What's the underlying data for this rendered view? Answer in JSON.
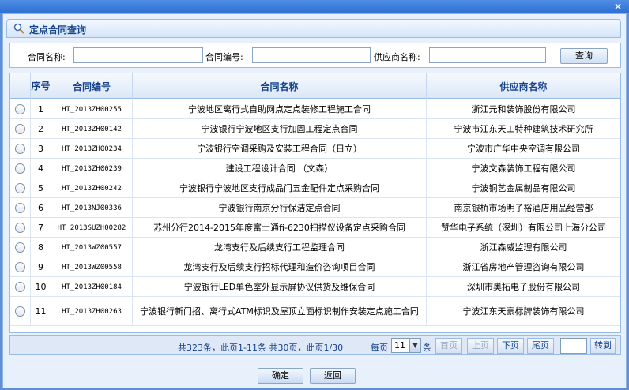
{
  "window": {
    "close_glyph": "×"
  },
  "panel": {
    "title": "定点合同查询",
    "icon": "search-icon"
  },
  "search": {
    "contract_name_label": "合同名称:",
    "contract_name_value": "",
    "contract_no_label": "合同编号:",
    "contract_no_value": "",
    "supplier_label": "供应商名称:",
    "supplier_value": "",
    "query_button": "查询"
  },
  "grid": {
    "columns": [
      "序号",
      "合同编号",
      "合同名称",
      "供应商名称"
    ],
    "rows": [
      {
        "no": "1",
        "code": "HT_2013ZH00255",
        "name": "宁波地区离行式自助网点定点装修工程施工合同",
        "supplier": "浙江元和装饰股份有限公司"
      },
      {
        "no": "2",
        "code": "HT_2013ZH00142",
        "name": "宁波银行宁波地区支行加固工程定点合同",
        "supplier": "宁波市江东天工特种建筑技术研究所"
      },
      {
        "no": "3",
        "code": "HT_2013ZH00234",
        "name": "宁波银行空调采购及安装工程合同（日立）",
        "supplier": "宁波市广华中央空调有限公司"
      },
      {
        "no": "4",
        "code": "HT_2013ZH00239",
        "name": "建设工程设计合同  （文森）",
        "supplier": "宁波文森装饰工程有限公司"
      },
      {
        "no": "5",
        "code": "HT_2013ZH00242",
        "name": "宁波银行宁波地区支行成品门五金配件定点采购合同",
        "supplier": "宁波铜艺金属制品有限公司"
      },
      {
        "no": "6",
        "code": "HT_2013NJ00336",
        "name": "宁波银行南京分行保洁定点合同",
        "supplier": "南京银桥市场明子裕酒店用品经营部"
      },
      {
        "no": "7",
        "code": "HT_2013SUZH00282",
        "name": "苏州分行2014-2015年度富士通fi-6230扫描仪设备定点采购合同",
        "supplier": "赞华电子系统（深圳）有限公司上海分公司"
      },
      {
        "no": "8",
        "code": "HT_2013WZ00557",
        "name": "龙湾支行及后续支行工程监理合同",
        "supplier": "浙江森威监理有限公司"
      },
      {
        "no": "9",
        "code": "HT_2013WZ00558",
        "name": "龙湾支行及后续支行招标代理和造价咨询项目合同",
        "supplier": "浙江省房地产管理咨询有限公司"
      },
      {
        "no": "10",
        "code": "HT_2013ZH00184",
        "name": "宁波银行LED单色室外显示屏协议供货及维保合同",
        "supplier": "深圳市奥拓电子股份有限公司"
      },
      {
        "no": "11",
        "code": "HT_2013ZH00263",
        "name": "宁波银行新门招、离行式ATM标识及屋顶立面标识制作安装定点施工合同",
        "supplier": "宁波江东天豪标牌装饰有限公司"
      }
    ]
  },
  "pager": {
    "info": "共323条，此页1-11条 共30页，此页1/30",
    "per_page_label": "每页",
    "per_page_value": "11",
    "per_page_suffix": "条",
    "first": "首页",
    "prev": "上页",
    "next": "下页",
    "last": "尾页",
    "page_input": "",
    "goto": "转到"
  },
  "footer": {
    "confirm": "确定",
    "back": "返回"
  },
  "colors": {
    "accent": "#15428b",
    "window": "#e8f0fb",
    "titlebar": "#2c6fd3"
  }
}
